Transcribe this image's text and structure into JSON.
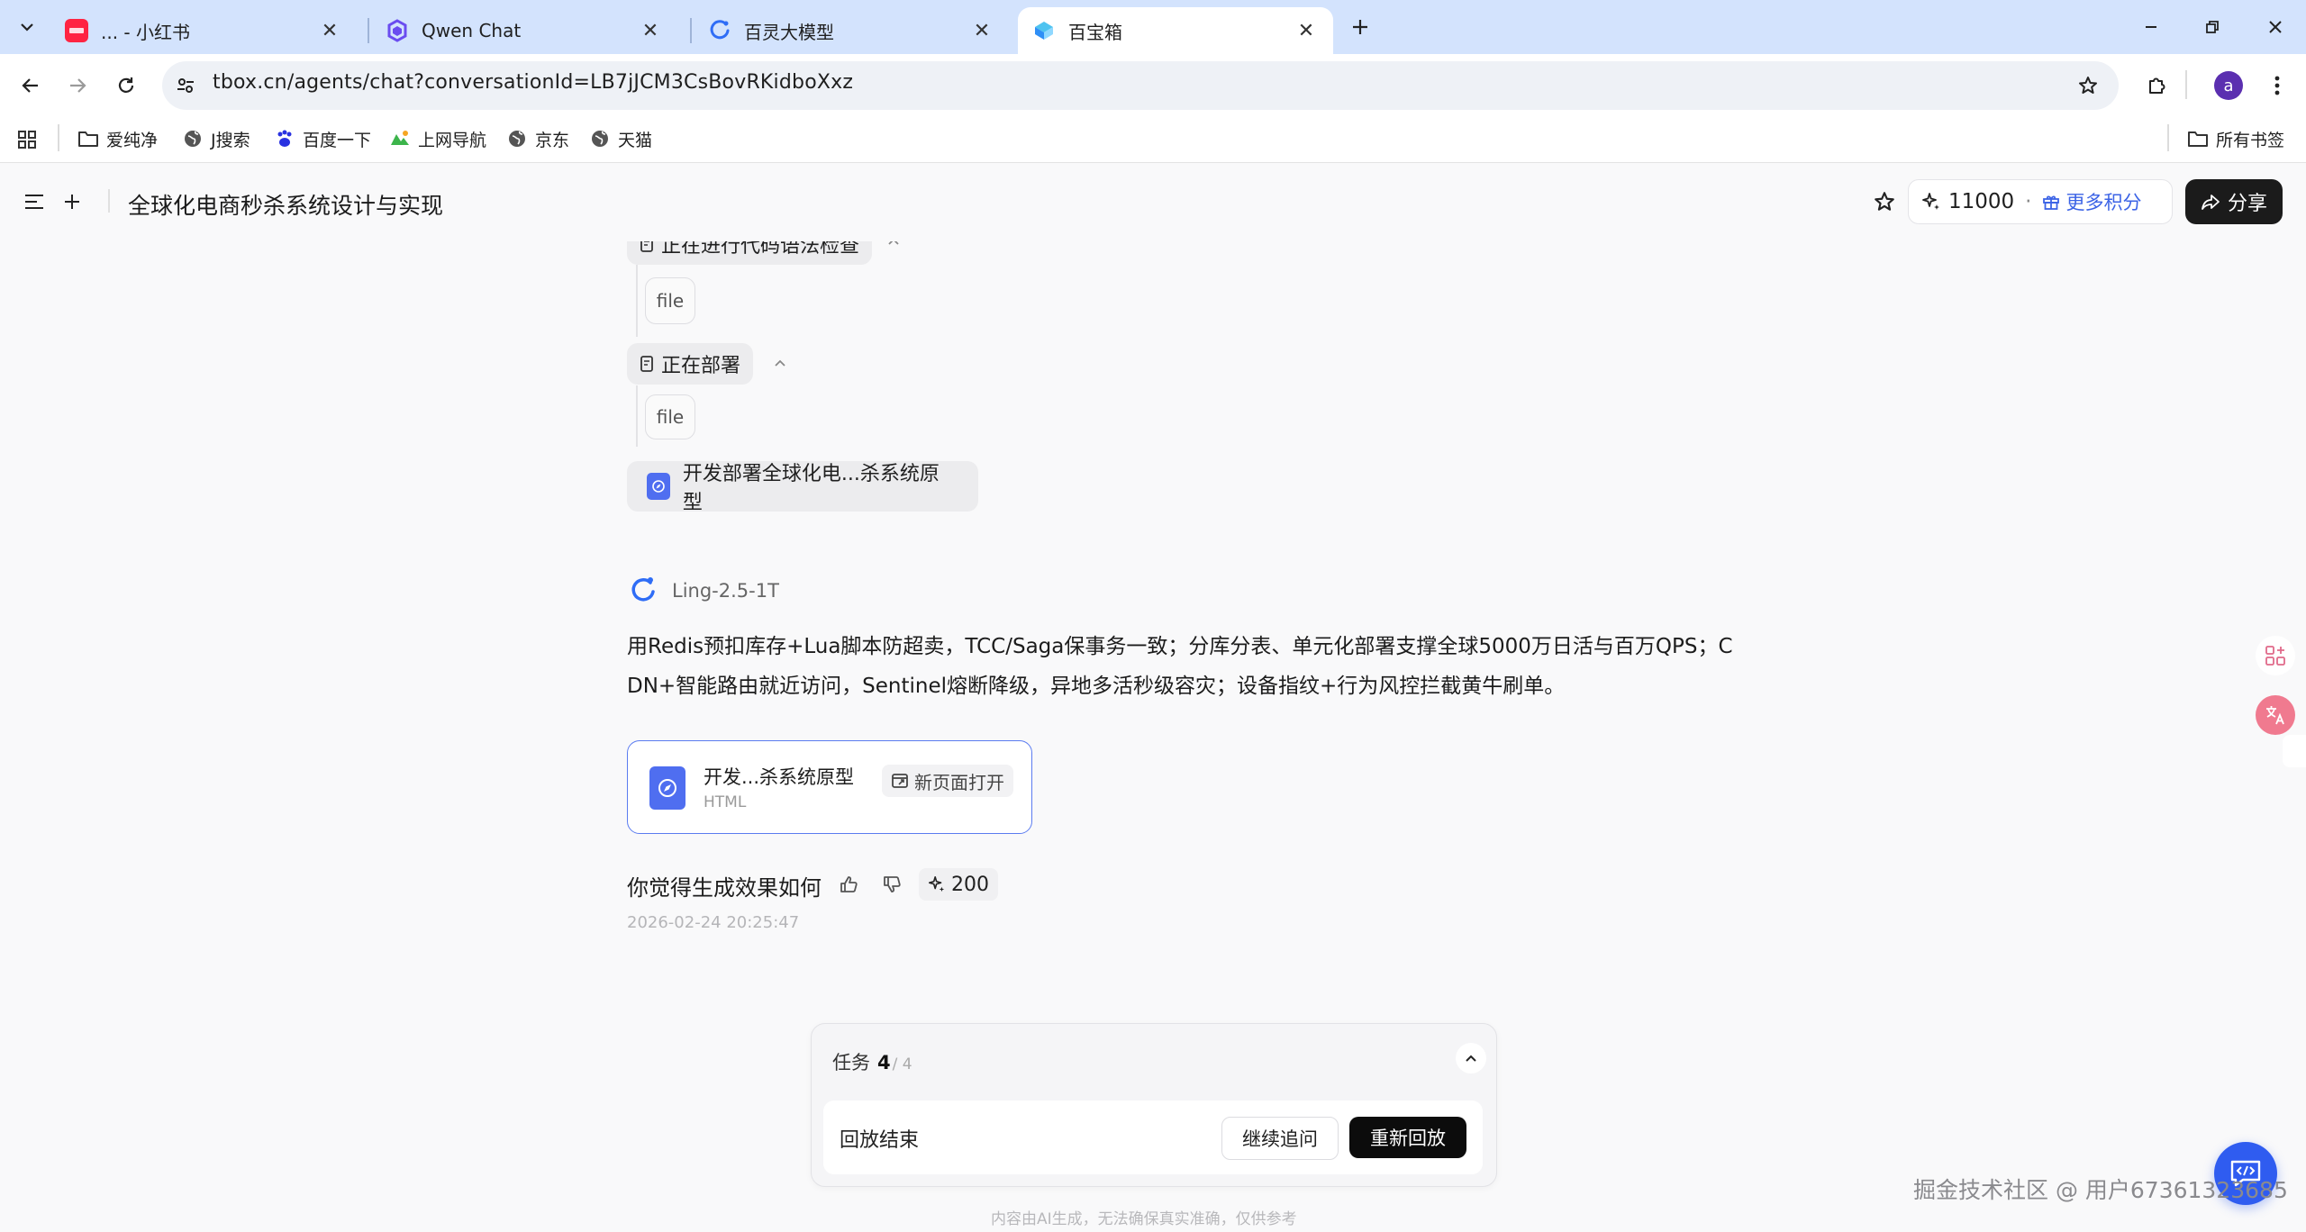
{
  "browser": {
    "tabs": [
      {
        "title": "... - 小红书",
        "active": false
      },
      {
        "title": "Qwen Chat",
        "active": false
      },
      {
        "title": "百灵大模型",
        "active": false
      },
      {
        "title": "百宝箱",
        "active": true
      }
    ],
    "url": "tbox.cn/agents/chat?conversationId=LB7jJCM3CsBovRKidboXxz",
    "profile_initial": "a",
    "bookmarks": [
      "爱纯净",
      "J搜索",
      "百度一下",
      "上网导航",
      "京东",
      "天猫"
    ],
    "all_bookmarks": "所有书签"
  },
  "app": {
    "title": "全球化电商秒杀系统设计与实现",
    "points": "11000",
    "more_points": "更多积分",
    "share": "分享"
  },
  "chat": {
    "step_partial": "正在进行代码语法检查",
    "file_chip_1": "file",
    "step_deploy": "正在部署",
    "file_chip_2": "file",
    "task_card": "开发部署全球化电...杀系统原型",
    "model_name": "Ling-2.5-1T",
    "answer_line1": "用Redis预扣库存+Lua脚本防超卖，TCC/Saga保事务一致；分库分表、单元化部署支撑全球5000万日活与百万QPS；C",
    "answer_line2": "DN+智能路由就近访问，Sentinel熔断降级，异地多活秒级容灾；设备指纹+行为风控拦截黄牛刷单。",
    "artifact": {
      "name": "开发...杀系统原型",
      "type": "HTML",
      "open_new": "新页面打开"
    },
    "feedback_question": "你觉得生成效果如何",
    "credits_used": "200",
    "timestamp": "2026-02-24 20:25:47"
  },
  "task_panel": {
    "label": "任务",
    "current": "4",
    "total": "/ 4",
    "status": "回放结束",
    "continue": "继续追问",
    "replay": "重新回放"
  },
  "footer": {
    "disclaimer": "内容由AI生成，无法确保真实准确，仅供参考",
    "watermark": "掘金技术社区 @ 用户67361323685"
  }
}
